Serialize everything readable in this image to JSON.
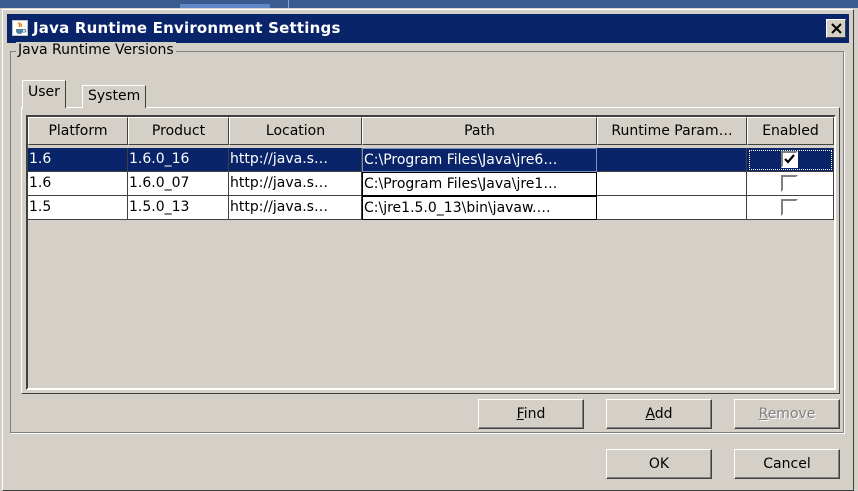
{
  "window": {
    "title": "Java Runtime Environment Settings"
  },
  "group": {
    "label": "Java Runtime Versions"
  },
  "tabs": [
    {
      "label": "User",
      "active": true
    },
    {
      "label": "System",
      "active": false
    }
  ],
  "table": {
    "columns": [
      "Platform",
      "Product",
      "Location",
      "Path",
      "Runtime Param…",
      "Enabled"
    ],
    "rows": [
      {
        "platform": "1.6",
        "product": "1.6.0_16",
        "location": "http://java.s…",
        "path": "C:\\Program Files\\Java\\jre6…",
        "runtime_params": "",
        "enabled": true,
        "selected": true
      },
      {
        "platform": "1.6",
        "product": "1.6.0_07",
        "location": "http://java.s…",
        "path": "C:\\Program Files\\Java\\jre1…",
        "runtime_params": "",
        "enabled": false,
        "selected": false
      },
      {
        "platform": "1.5",
        "product": "1.5.0_13",
        "location": "http://java.s…",
        "path": "C:\\jre1.5.0_13\\bin\\javaw.…",
        "runtime_params": "",
        "enabled": false,
        "selected": false
      }
    ]
  },
  "buttons": {
    "find": {
      "mnemonic": "F",
      "rest": "ind"
    },
    "add": {
      "mnemonic": "A",
      "rest": "dd"
    },
    "remove": {
      "mnemonic": "R",
      "rest": "emove",
      "disabled": true
    },
    "ok": "OK",
    "cancel": "Cancel"
  },
  "icons": {
    "app": "java-cup-icon",
    "close": "close-icon",
    "check": "checkmark-icon"
  },
  "colors": {
    "titlebar": "#0a246a",
    "selection": "#0a246a",
    "dialog_bg": "#d4d0c8"
  }
}
